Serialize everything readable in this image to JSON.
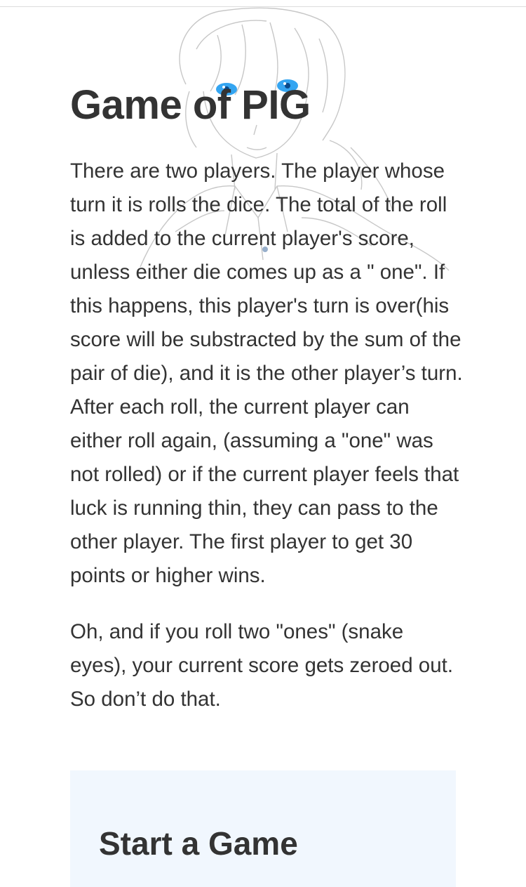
{
  "page": {
    "title": "Game of PIG",
    "paragraphs": [
      "There are two players. The player whose turn it is rolls the dice. The total of the roll is added to the current player's score, unless either die comes up as a \" one\". If this happens, this player's turn is over(his score will be substracted by the sum of the pair of die), and it is the other player’s turn. After each roll, the current player can either roll again, (assuming a \"one\" was not rolled) or if the current player feels that luck is running thin, they can pass to the other player. The first player to get 30 points or higher wins.",
      "Oh, and if you roll two \"ones\" (snake eyes), your current score gets zeroed out. So don’t do that."
    ]
  },
  "start_panel": {
    "heading": "Start a Game",
    "background": "#f1f7fe"
  },
  "colors": {
    "text": "#333333",
    "eyes": "#1e9bf0"
  },
  "background_image": {
    "subject": "anime-character-illustration"
  }
}
